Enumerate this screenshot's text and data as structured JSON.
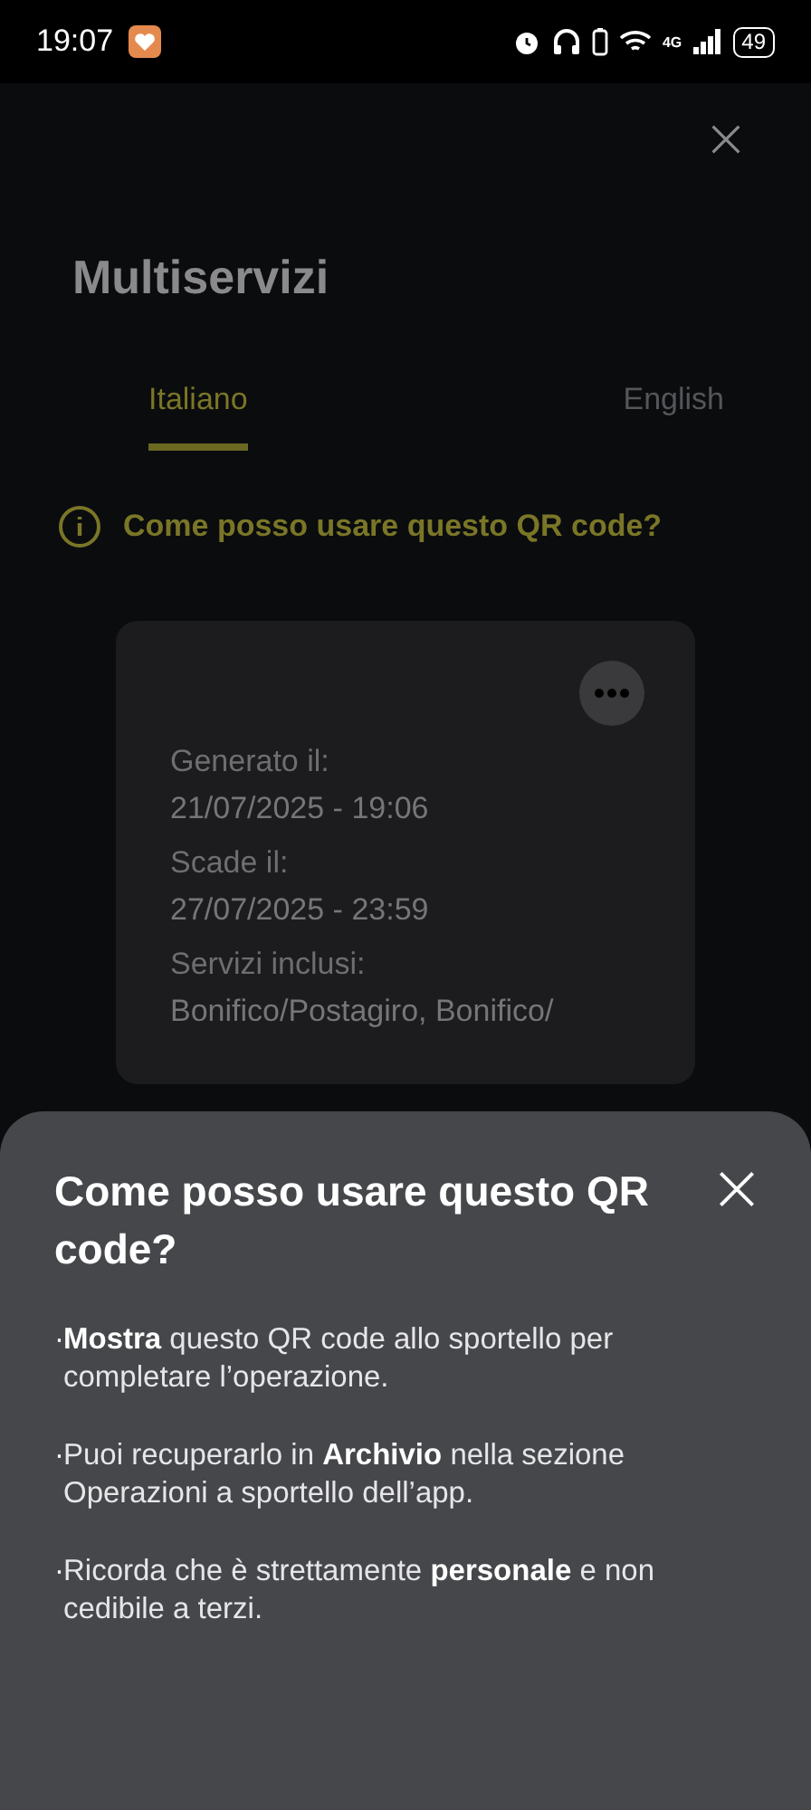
{
  "status_bar": {
    "time": "19:07",
    "battery": "49",
    "network": "4G"
  },
  "header": {
    "title": "Multiservizi"
  },
  "tabs": [
    {
      "label": "Italiano",
      "selected": true
    },
    {
      "label": "English",
      "selected": false
    }
  ],
  "info_link": {
    "label": "Come posso usare questo QR code?"
  },
  "card": {
    "fields": [
      {
        "label": "Generato il:",
        "value": "21/07/2025 - 19:06"
      },
      {
        "label": "Scade il:",
        "value": "27/07/2025 - 23:59"
      },
      {
        "label": "Servizi inclusi:",
        "value": "Bonifico/Postagiro, Bonifico/"
      }
    ]
  },
  "sheet": {
    "title": "Come posso usare questo QR code?",
    "items": [
      {
        "marker": "·",
        "text": "**Mostra** questo QR code allo sportello per completare l’operazione."
      },
      {
        "marker": "·",
        "text": "Puoi recuperarlo in **Archivio** nella sezione Operazioni a sportello dell’app."
      },
      {
        "marker": "·",
        "text": "Ricorda che è strettamente **personale** e non cedibile a terzi."
      }
    ]
  }
}
